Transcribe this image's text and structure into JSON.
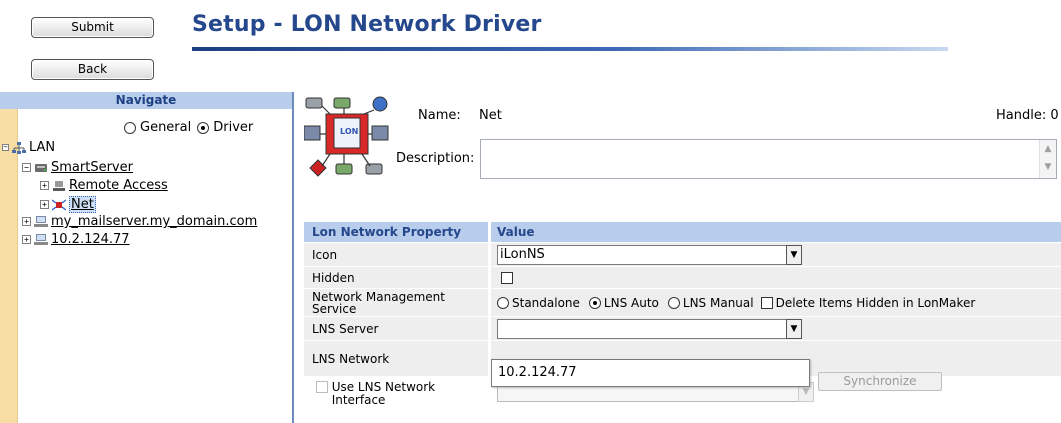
{
  "header": {
    "title": "Setup - LON Network Driver",
    "submit_label": "Submit",
    "back_label": "Back"
  },
  "navigate": {
    "title": "Navigate",
    "mode_general": "General",
    "mode_driver": "Driver",
    "tree": {
      "lan": "LAN",
      "smartserver": "SmartServer",
      "remote_access": "Remote Access",
      "net": "Net",
      "mailserver": "my_mailserver.my_domain.com",
      "ip": "10.2.124.77"
    }
  },
  "details": {
    "name_label": "Name:",
    "name_value": "Net",
    "handle_label": "Handle: 0",
    "description_label": "Description:",
    "description_value": ""
  },
  "properties": {
    "col_property": "Lon Network Property",
    "col_value": "Value",
    "icon_label": "Icon",
    "icon_value": "iLonNS",
    "hidden_label": "Hidden",
    "nms_label": "Network Management Service",
    "nms_opt_standalone": "Standalone",
    "nms_opt_lns_auto": "LNS Auto",
    "nms_opt_lns_manual": "LNS Manual",
    "nms_delete_hidden": "Delete Items Hidden in LonMaker",
    "lns_server_label": "LNS Server",
    "lns_server_value": "",
    "lns_network_label": "LNS Network",
    "lns_server_option": "10.2.124.77",
    "synchronize_label": "Synchronize",
    "use_lns_label": "Use LNS Network Interface"
  },
  "colors": {
    "title_blue": "#25478b",
    "header_band": "#b8cdec",
    "side_strip": "#f8dea5",
    "row_bg": "#eeeeee"
  }
}
